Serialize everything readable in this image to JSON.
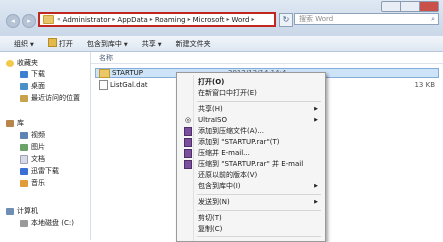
{
  "address_bar": {
    "crumbs": [
      "Administrator",
      "AppData",
      "Roaming",
      "Microsoft",
      "Word"
    ],
    "prefix": "«",
    "separator": "▸"
  },
  "search": {
    "placeholder": "搜索 Word"
  },
  "toolbar": {
    "organize": "组织",
    "open": "打开",
    "include_in_library": "包含到库中",
    "share": "共享",
    "new_folder": "新建文件夹"
  },
  "sidebar": {
    "favorites": {
      "label": "收藏夹",
      "items": [
        "下载",
        "桌面",
        "最近访问的位置"
      ]
    },
    "libraries": {
      "label": "库",
      "items": [
        "视频",
        "图片",
        "文档",
        "迅雷下载",
        "音乐"
      ]
    },
    "computer": {
      "label": "计算机",
      "items": [
        "本地磁盘 (C:)"
      ]
    }
  },
  "file_list": {
    "columns": {
      "name": "名称"
    },
    "rows": [
      {
        "name": "STARTUP",
        "type": "folder",
        "date": "2012/12/14 14:4",
        "size": "",
        "selected": true
      },
      {
        "name": "ListGal.dat",
        "type": "file",
        "date": "",
        "size": "13 KB",
        "selected": false
      }
    ]
  },
  "context_menu": {
    "items": [
      {
        "label": "打开(O)",
        "bold": true
      },
      {
        "label": "在新窗口中打开(E)"
      },
      {
        "sep": true
      },
      {
        "label": "共享(H)",
        "submenu": true
      },
      {
        "label": "UltraISO",
        "submenu": true,
        "icon": "ultraiso-icon"
      },
      {
        "label": "添加到压缩文件(A)...",
        "icon": "winrar-icon"
      },
      {
        "label": "添加到 \"STARTUP.rar\"(T)",
        "icon": "winrar-icon"
      },
      {
        "label": "压缩并 E-mail...",
        "icon": "winrar-icon"
      },
      {
        "label": "压缩到 \"STARTUP.rar\" 并 E-mail",
        "icon": "winrar-icon"
      },
      {
        "label": "还原以前的版本(V)"
      },
      {
        "label": "包含到库中(I)",
        "submenu": true
      },
      {
        "sep": true
      },
      {
        "label": "发送到(N)",
        "submenu": true
      },
      {
        "sep": true
      },
      {
        "label": "剪切(T)"
      },
      {
        "label": "复制(C)"
      },
      {
        "sep": true
      },
      {
        "label": "创建快捷方式(S)"
      }
    ]
  },
  "colors": {
    "address_highlight": "#c0271e",
    "selection": "#cde3f8",
    "toolbar_bg": "#dde6f1"
  }
}
